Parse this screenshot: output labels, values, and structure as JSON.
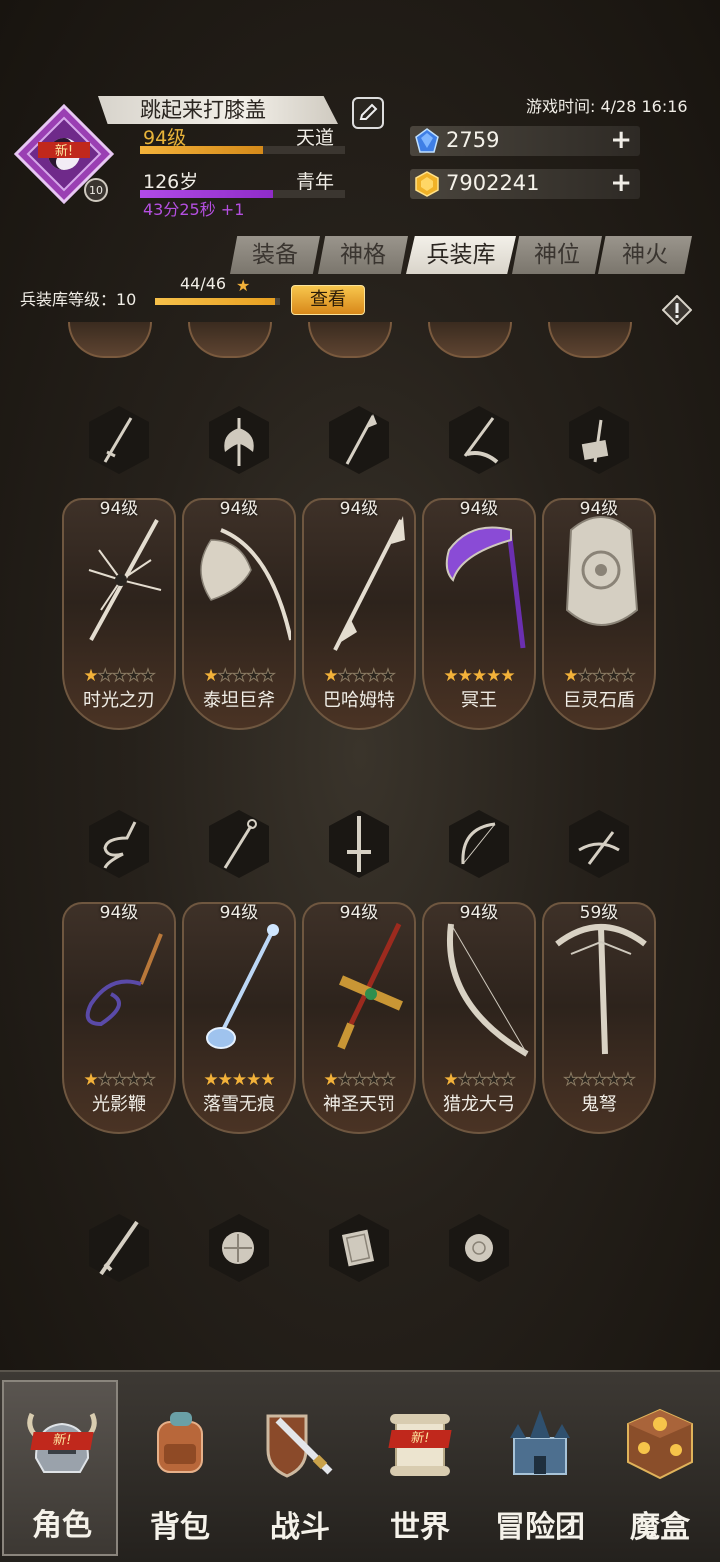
{
  "header": {
    "badge": "新!",
    "emblem_level": "10",
    "player_name": "跳起来打膝盖",
    "level": "94级",
    "realm": "天道",
    "age": "126岁",
    "life_stage": "青年",
    "timer": "43分25秒 +1",
    "game_time": "游戏时间: 4/28 16:16",
    "level_progress": 0.6,
    "age_progress": 0.65
  },
  "currency": {
    "gems": "2759",
    "gold": "7902241"
  },
  "tabs": [
    "装备",
    "神格",
    "兵装库",
    "神位",
    "神火"
  ],
  "active_tab": "兵装库",
  "armory": {
    "label": "兵装库等级：10",
    "progress_text": "44/46",
    "progress": 0.957,
    "view_button": "查看"
  },
  "weapons_row1": [
    {
      "level": "94级",
      "name": "时光之刃",
      "stars": 1
    },
    {
      "level": "94级",
      "name": "泰坦巨斧",
      "stars": 1
    },
    {
      "level": "94级",
      "name": "巴哈姆特",
      "stars": 1
    },
    {
      "level": "94级",
      "name": "冥王",
      "stars": 5
    },
    {
      "level": "94级",
      "name": "巨灵石盾",
      "stars": 1
    }
  ],
  "weapons_row2": [
    {
      "level": "94级",
      "name": "光影鞭",
      "stars": 1
    },
    {
      "level": "94级",
      "name": "落雪无痕",
      "stars": 5
    },
    {
      "level": "94级",
      "name": "神圣天罚",
      "stars": 1
    },
    {
      "level": "94级",
      "name": "猎龙大弓",
      "stars": 1
    },
    {
      "level": "59级",
      "name": "鬼弩",
      "stars": 0
    }
  ],
  "nav": [
    {
      "label": "角色",
      "icon": "helmet-icon",
      "badge": "新!"
    },
    {
      "label": "背包",
      "icon": "backpack-icon"
    },
    {
      "label": "战斗",
      "icon": "sword-shield-icon"
    },
    {
      "label": "世界",
      "icon": "scroll-icon",
      "badge": "新!"
    },
    {
      "label": "冒险团",
      "icon": "castle-icon"
    },
    {
      "label": "魔盒",
      "icon": "magic-box-icon"
    }
  ]
}
